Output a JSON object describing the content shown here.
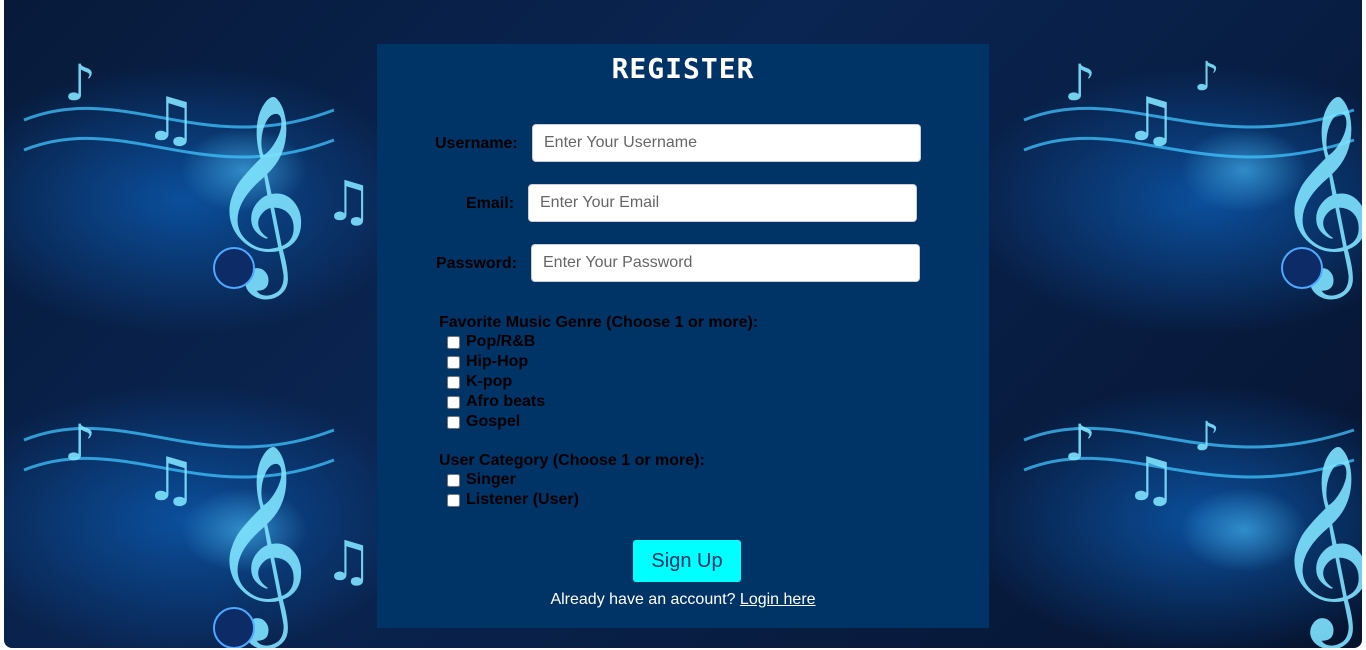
{
  "form": {
    "title": "REGISTER",
    "username": {
      "label": "Username:",
      "placeholder": "Enter Your Username",
      "value": ""
    },
    "email": {
      "label": "Email:",
      "placeholder": "Enter Your Email",
      "value": ""
    },
    "password": {
      "label": "Password:",
      "placeholder": "Enter Your Password",
      "value": ""
    },
    "genre": {
      "label": "Favorite Music Genre (Choose 1 or more):",
      "options": [
        {
          "label": "Pop/R&B",
          "checked": false
        },
        {
          "label": "Hip-Hop",
          "checked": false
        },
        {
          "label": "K-pop",
          "checked": false
        },
        {
          "label": "Afro beats",
          "checked": false
        },
        {
          "label": "Gospel",
          "checked": false
        }
      ]
    },
    "category": {
      "label": "User Category (Choose 1 or more):",
      "options": [
        {
          "label": "Singer",
          "checked": false
        },
        {
          "label": "Listener (User)",
          "checked": false
        }
      ]
    },
    "submit_label": "Sign Up",
    "login_prompt": "Already have an account?",
    "login_link": "Login here"
  },
  "background": {
    "theme": "music-notes-blue-wallpaper",
    "icons": [
      "treble-clef-icon",
      "music-note-icon"
    ]
  },
  "colors": {
    "card": "#003366",
    "button": "#00ffff",
    "text_on_card": "#ffffff"
  }
}
